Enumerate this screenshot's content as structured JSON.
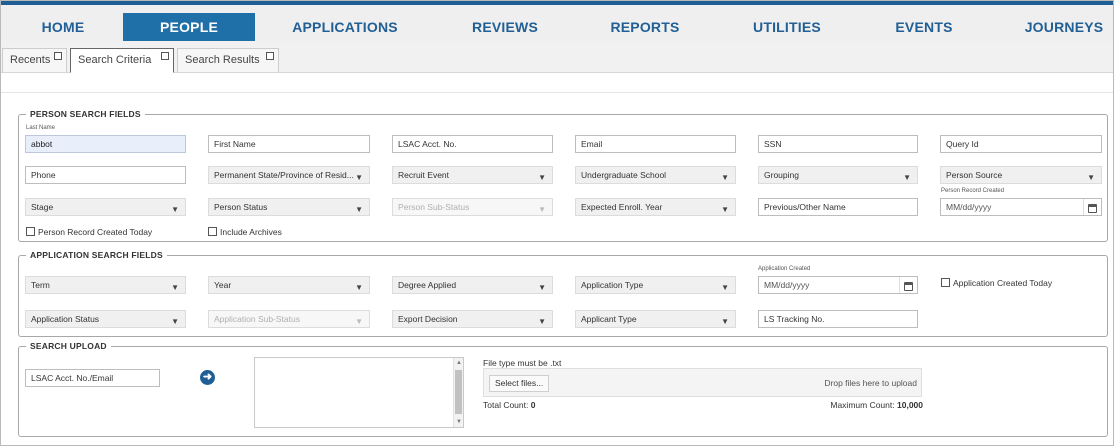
{
  "nav": {
    "items": [
      "HOME",
      "PEOPLE",
      "APPLICATIONS",
      "REVIEWS",
      "REPORTS",
      "UTILITIES",
      "EVENTS",
      "JOURNEYS"
    ],
    "active": "PEOPLE",
    "accent": "#1f6fa8"
  },
  "tabs": [
    "Recents",
    "Search Criteria",
    "Search Results"
  ],
  "person": {
    "title": "PERSON SEARCH FIELDS",
    "last_name_label": "Last Name",
    "last_name_value": "abbot",
    "first_name": "First Name",
    "lsac_acct": "LSAC Acct. No.",
    "email": "Email",
    "ssn": "SSN",
    "query_id": "Query Id",
    "phone": "Phone",
    "permanent_state": "Permanent State/Province of Resid...",
    "recruit_event": "Recruit Event",
    "undergrad_school": "Undergraduate School",
    "grouping": "Grouping",
    "person_source": "Person Source",
    "stage": "Stage",
    "person_status": "Person Status",
    "person_sub_status": "Person Sub-Status",
    "expected_enroll_year": "Expected Enroll. Year",
    "previous_name": "Previous/Other Name",
    "record_created_label": "Person Record Created",
    "record_created_placeholder": "MM/dd/yyyy",
    "created_today": "Person Record Created Today",
    "include_archives": "Include Archives"
  },
  "application": {
    "title": "APPLICATION SEARCH FIELDS",
    "term": "Term",
    "year": "Year",
    "degree_applied": "Degree Applied",
    "application_type": "Application Type",
    "created_label": "Application Created",
    "created_placeholder": "MM/dd/yyyy",
    "created_today": "Application Created Today",
    "application_status": "Application Status",
    "application_sub_status": "Application Sub-Status",
    "export_decision": "Export Decision",
    "applicant_type": "Applicant Type",
    "ls_tracking": "LS Tracking No."
  },
  "upload": {
    "title": "SEARCH UPLOAD",
    "key_field": "LSAC Acct. No./Email",
    "file_type_note": "File type must be .txt",
    "select_files": "Select files...",
    "drop_text": "Drop files here to upload",
    "total_count_label": "Total Count:",
    "total_count_value": "0",
    "max_count_label": "Maximum Count:",
    "max_count_value": "10,000"
  },
  "icons": {
    "dropdown": "chevron-down-icon",
    "calendar": "calendar-icon",
    "go": "arrow-right-circle-icon"
  }
}
